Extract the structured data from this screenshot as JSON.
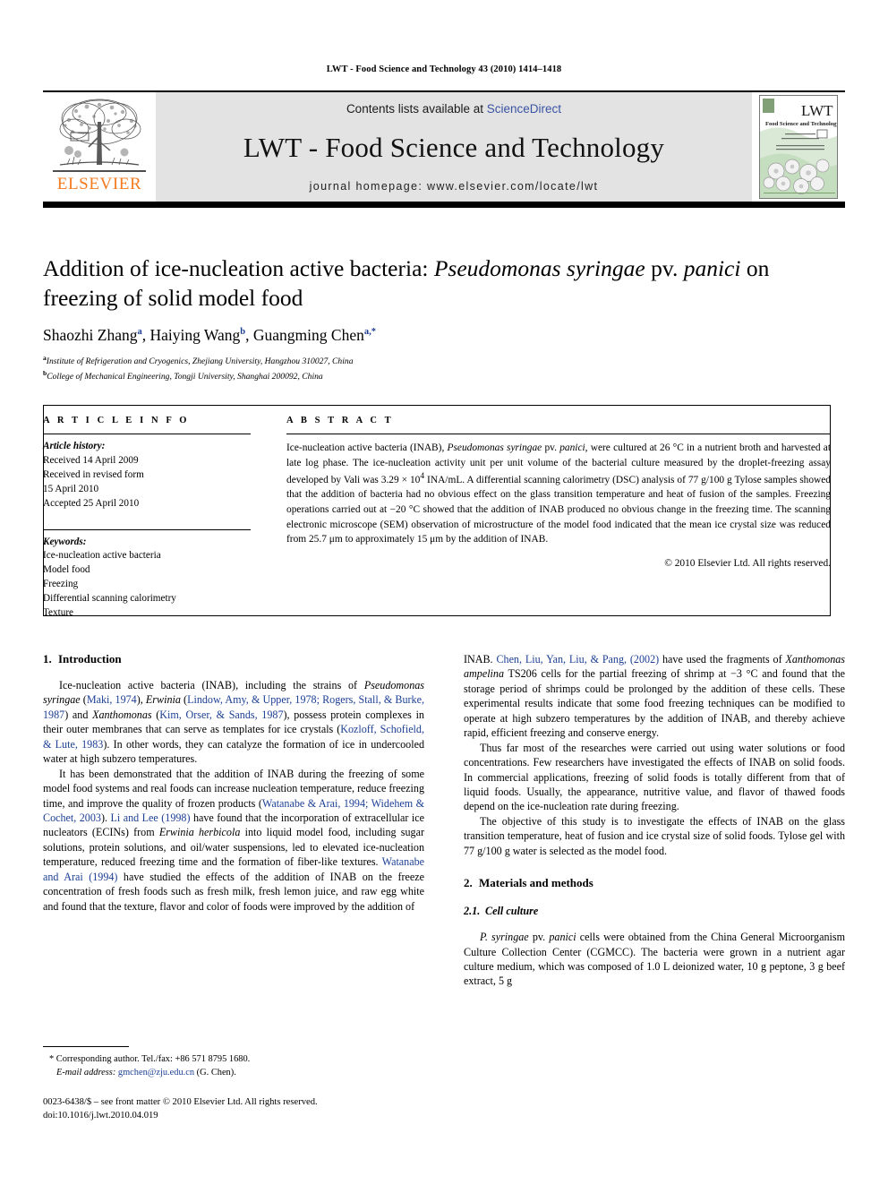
{
  "running_head": "LWT - Food Science and Technology 43 (2010) 1414–1418",
  "masthead": {
    "contents_prefix": "Contents lists available at ",
    "sciencedirect": "ScienceDirect",
    "journal_title": "LWT - Food Science and Technology",
    "homepage": "journal homepage: www.elsevier.com/locate/lwt",
    "publisher_wordmark": "ELSEVIER",
    "publisher_color": "#F47B20",
    "link_color": "#3a53a4",
    "panel_color": "#e3e3e3",
    "cover_title": "LWT -",
    "cover_subtitle": "Food Science and Technology"
  },
  "article": {
    "title_line1_a": "Addition of ice-nucleation active bacteria: ",
    "title_line1_italic": "Pseudomonas syringae",
    "title_line1_b": " pv. ",
    "title_line1_italic2": "panici",
    "title_line1_c": " on",
    "title_line2": "freezing of solid model food",
    "authors_1": "Shaozhi Zhang",
    "authors_sup_1": "a",
    "authors_2": ", Haiying Wang",
    "authors_sup_2": "b",
    "authors_3": ", Guangming Chen",
    "authors_sup_3": "a,*",
    "affiliation_a_marker": "a",
    "affiliation_a": "Institute of Refrigeration and Cryogenics, Zhejiang University, Hangzhou 310027, China",
    "affiliation_b_marker": "b",
    "affiliation_b": "College of Mechanical Engineering, Tongji University, Shanghai 200092, China"
  },
  "article_info": {
    "heading": "A R T I C L E  I N F O",
    "history_label": "Article history:",
    "history": [
      "Received 14 April 2009",
      "Received in revised form",
      "15 April 2010",
      "Accepted 25 April 2010"
    ],
    "keywords_label": "Keywords:",
    "keywords": [
      "Ice-nucleation active bacteria",
      "Model food",
      "Freezing",
      "Differential scanning calorimetry",
      "Texture"
    ]
  },
  "abstract": {
    "heading": "A B S T R A C T",
    "p1_a": "Ice-nucleation active bacteria (INAB), ",
    "p1_italic1": "Pseudomonas syringae",
    "p1_b": " pv. ",
    "p1_italic2": "panici",
    "p1_c": ", were cultured at 26 °C in a nutrient broth and harvested at late log phase. The ice-nucleation activity unit per unit volume of the bacterial culture measured by the droplet-freezing assay developed by Vali was 3.29 × 10",
    "p1_sup": "4",
    "p1_d": " INA/mL. A differential scanning calorimetry (DSC) analysis of 77 g/100 g Tylose samples showed that the addition of bacteria had no obvious effect on the glass transition temperature and heat of fusion of the samples. Freezing operations carried out at −20 °C showed that the addition of INAB produced no obvious change in the freezing time. The scanning electronic microscope (SEM) observation of microstructure of the model food indicated that the mean ice crystal size was reduced from 25.7 μm to approximately 15 μm by the addition of INAB.",
    "copyright": "© 2010 Elsevier Ltd. All rights reserved."
  },
  "sections": {
    "intro_num": "1.",
    "intro_title": "Introduction",
    "methods_num": "2.",
    "methods_title": "Materials and methods",
    "cellculture_num": "2.1.",
    "cellculture_title": "Cell culture"
  },
  "left_column": {
    "p1_a": "Ice-nucleation active bacteria (INAB), including the strains of ",
    "p1_i1": "Pseudomonas syringae",
    "p1_b": " (",
    "p1_r1": "Maki, 1974",
    "p1_c": "), ",
    "p1_i2": "Erwinia",
    "p1_d": " (",
    "p1_r2": "Lindow, Amy, & Upper, 1978; Rogers, Stall, & Burke, 1987",
    "p1_e": ") and ",
    "p1_i3": "Xanthomonas",
    "p1_f": " (",
    "p1_r3": "Kim, Orser, & Sands, 1987",
    "p1_g": "), possess protein complexes in their outer membranes that can serve as templates for ice crystals (",
    "p1_r4": "Kozloff, Schofield, & Lute, 1983",
    "p1_h": "). In other words, they can catalyze the formation of ice in undercooled water at high subzero temperatures.",
    "p2_a": "It has been demonstrated that the addition of INAB during the freezing of some model food systems and real foods can increase nucleation temperature, reduce freezing time, and improve the quality of frozen products (",
    "p2_r1": "Watanabe & Arai, 1994; Widehem & Cochet, 2003",
    "p2_b": "). ",
    "p2_r2": "Li and Lee (1998)",
    "p2_c": " have found that the incorporation of extracellular ice nucleators (ECINs) from ",
    "p2_i1": "Erwinia herbicola",
    "p2_d": " into liquid model food, including sugar solutions, protein solutions, and oil/water suspensions, led to elevated ice-nucleation temperature, reduced freezing time and the formation of fiber-like textures. ",
    "p2_r3": "Watanabe and Arai (1994)",
    "p2_e": " have studied the effects of the addition of INAB on the freeze concentration of fresh foods such as fresh milk, fresh lemon juice, and raw egg white and found that the texture, flavor and color of foods were improved by the addition of"
  },
  "right_column": {
    "p1_a": "INAB. ",
    "p1_r1": "Chen, Liu, Yan, Liu, & Pang, (2002)",
    "p1_b": " have used the fragments of ",
    "p1_i1": "Xanthomonas ampelina",
    "p1_c": " TS206 cells for the partial freezing of shrimp at −3 °C and found that the storage period of shrimps could be prolonged by the addition of these cells. These experimental results indicate that some food freezing techniques can be modified to operate at high subzero temperatures by the addition of INAB, and thereby achieve rapid, efficient freezing and conserve energy.",
    "p2": "Thus far most of the researches were carried out using water solutions or food concentrations. Few researchers have investigated the effects of INAB on solid foods. In commercial applications, freezing of solid foods is totally different from that of liquid foods. Usually, the appearance, nutritive value, and flavor of thawed foods depend on the ice-nucleation rate during freezing.",
    "p3": "The objective of this study is to investigate the effects of INAB on the glass transition temperature, heat of fusion and ice crystal size of solid foods. Tylose gel with 77 g/100 g water is selected as the model food.",
    "p4_i1": "P. syringae",
    "p4_a": " pv. ",
    "p4_i2": "panici",
    "p4_b": " cells were obtained from the China General Microorganism Culture Collection Center (CGMCC). The bacteria were grown in a nutrient agar culture medium, which was composed of 1.0 L deionized water, 10 g peptone, 3 g beef extract, 5 g"
  },
  "footnotes": {
    "corresponding": "* Corresponding author. Tel./fax: +86 571 8795 1680.",
    "email_label": "E-mail address:",
    "email": "gmchen@zju.edu.cn",
    "email_suffix": " (G. Chen).",
    "imprint_line1": "0023-6438/$ – see front matter © 2010 Elsevier Ltd. All rights reserved.",
    "imprint_line2": "doi:10.1016/j.lwt.2010.04.019"
  }
}
